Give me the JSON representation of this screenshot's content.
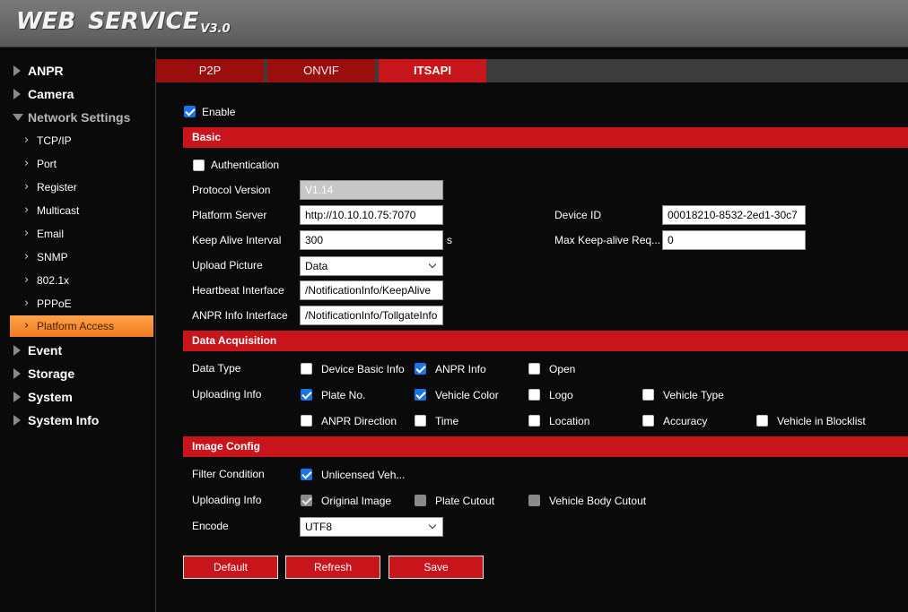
{
  "header": {
    "brand_word1": "WEB",
    "brand_word2": "SERVICE",
    "version": "V3.0"
  },
  "sidebar": {
    "items": [
      {
        "label": "ANPR"
      },
      {
        "label": "Camera"
      },
      {
        "label": "Network Settings"
      },
      {
        "label": "Event"
      },
      {
        "label": "Storage"
      },
      {
        "label": "System"
      },
      {
        "label": "System Info"
      }
    ],
    "network_sub": [
      {
        "label": "TCP/IP"
      },
      {
        "label": "Port"
      },
      {
        "label": "Register"
      },
      {
        "label": "Multicast"
      },
      {
        "label": "Email"
      },
      {
        "label": "SNMP"
      },
      {
        "label": "802.1x"
      },
      {
        "label": "PPPoE"
      },
      {
        "label": "Platform Access"
      }
    ]
  },
  "tabs": [
    {
      "label": "P2P"
    },
    {
      "label": "ONVIF"
    },
    {
      "label": "ITSAPI"
    }
  ],
  "enable": {
    "label": "Enable",
    "checked": true
  },
  "basic": {
    "title": "Basic",
    "authentication": {
      "label": "Authentication",
      "checked": false
    },
    "protocol_version": {
      "label": "Protocol Version",
      "value": "V1.14"
    },
    "platform_server": {
      "label": "Platform Server",
      "value": "http://10.10.10.75:7070"
    },
    "device_id": {
      "label": "Device ID",
      "value": "00018210-8532-2ed1-30c7"
    },
    "keep_alive": {
      "label": "Keep Alive Interval",
      "value": "300",
      "unit": "s"
    },
    "max_keepalive": {
      "label": "Max Keep-alive Req...",
      "value": "0"
    },
    "upload_picture": {
      "label": "Upload Picture",
      "value": "Data"
    },
    "heartbeat": {
      "label": "Heartbeat Interface",
      "value": "/NotificationInfo/KeepAlive"
    },
    "anpr_info": {
      "label": "ANPR Info Interface",
      "value": "/NotificationInfo/TollgateInfo"
    }
  },
  "data_acq": {
    "title": "Data Acquisition",
    "data_type_label": "Data Type",
    "data_type": [
      {
        "label": "Device Basic Info",
        "checked": false
      },
      {
        "label": "ANPR Info",
        "checked": true
      },
      {
        "label": "Open",
        "checked": false
      }
    ],
    "uploading_label": "Uploading Info",
    "uploading": [
      {
        "label": "Plate No.",
        "checked": true
      },
      {
        "label": "Vehicle Color",
        "checked": true
      },
      {
        "label": "Logo",
        "checked": false
      },
      {
        "label": "Vehicle Type",
        "checked": false
      },
      {
        "label": "ANPR Direction",
        "checked": false
      },
      {
        "label": "Time",
        "checked": false
      },
      {
        "label": "Location",
        "checked": false
      },
      {
        "label": "Accuracy",
        "checked": false
      },
      {
        "label": "Vehicle in Blocklist",
        "checked": false
      }
    ]
  },
  "image_config": {
    "title": "Image Config",
    "filter_label": "Filter Condition",
    "filter": {
      "label": "Unlicensed Veh...",
      "checked": true
    },
    "uploading_label": "Uploading Info",
    "uploading": [
      {
        "label": "Original Image",
        "checked": true,
        "disabled": true
      },
      {
        "label": "Plate Cutout",
        "checked": false,
        "disabled": true
      },
      {
        "label": "Vehicle Body Cutout",
        "checked": false,
        "disabled": true
      }
    ],
    "encode_label": "Encode",
    "encode_value": "UTF8"
  },
  "buttons": {
    "default": "Default",
    "refresh": "Refresh",
    "save": "Save"
  }
}
